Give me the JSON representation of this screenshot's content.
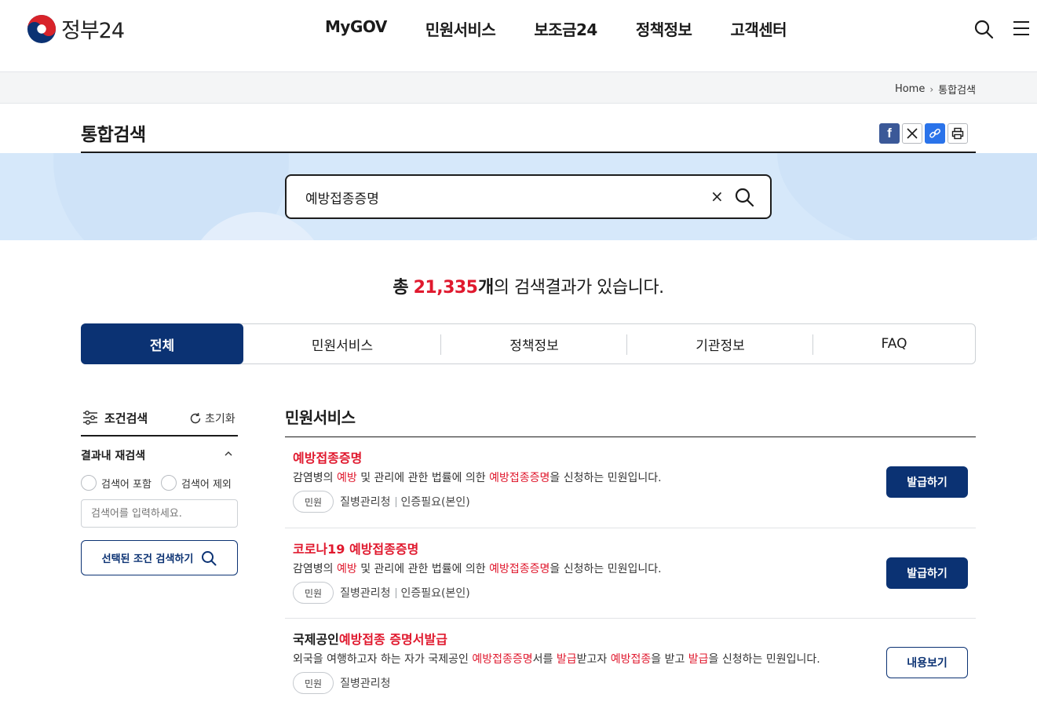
{
  "header": {
    "logo_text": "정부24",
    "nav": [
      "MyGOV",
      "민원서비스",
      "보조금24",
      "정책정보",
      "고객센터"
    ]
  },
  "breadcrumb": {
    "home": "Home",
    "current": "통합검색"
  },
  "page_title": "통합검색",
  "search": {
    "value": "예방접종증명"
  },
  "summary": {
    "prefix": "총",
    "count": "21,335",
    "unit": "개",
    "suffix": "의 검색결과가 있습니다."
  },
  "tabs": [
    "전체",
    "민원서비스",
    "정책정보",
    "기관정보",
    "FAQ"
  ],
  "filter": {
    "title": "조건검색",
    "reset": "초기화",
    "subtitle": "결과내 재검색",
    "include": "검색어 포함",
    "exclude": "검색어 제외",
    "placeholder": "검색어를 입력하세요.",
    "submit": "선택된 조건 검색하기"
  },
  "section_title": "민원서비스",
  "results": [
    {
      "title": [
        {
          "t": "예방접종증명",
          "h": true
        }
      ],
      "desc": [
        {
          "t": "감염병의 "
        },
        {
          "t": "예방",
          "h": true
        },
        {
          "t": " 및 관리에 관한 법률에 의한 "
        },
        {
          "t": "예방접종증명",
          "h": true
        },
        {
          "t": "을 신청하는 민원입니다."
        }
      ],
      "chip": "민원",
      "org": "질병관리청",
      "auth": "인증필요(본인)",
      "button": "발급하기",
      "button_style": "solid"
    },
    {
      "title": [
        {
          "t": "코로나19 예방접종증명",
          "h": true
        }
      ],
      "desc": [
        {
          "t": "감염병의 "
        },
        {
          "t": "예방",
          "h": true
        },
        {
          "t": " 및 관리에 관한 법률에 의한 "
        },
        {
          "t": "예방접종증명",
          "h": true
        },
        {
          "t": "을 신청하는 민원입니다."
        }
      ],
      "chip": "민원",
      "org": "질병관리청",
      "auth": "인증필요(본인)",
      "button": "발급하기",
      "button_style": "solid"
    },
    {
      "title": [
        {
          "t": "국제공인"
        },
        {
          "t": "예방접종 증명서발급",
          "h": true
        }
      ],
      "desc": [
        {
          "t": "외국을 여행하고자 하는 자가 국제공인 "
        },
        {
          "t": "예방접종증명",
          "h": true
        },
        {
          "t": "서를 "
        },
        {
          "t": "발급",
          "h": true
        },
        {
          "t": "받고자 "
        },
        {
          "t": "예방접종",
          "h": true
        },
        {
          "t": "을 받고 "
        },
        {
          "t": "발급",
          "h": true
        },
        {
          "t": "을 신청하는 민원입니다."
        }
      ],
      "chip": "민원",
      "org": "질병관리청",
      "auth": "",
      "button": "내용보기",
      "button_style": "outline"
    }
  ]
}
